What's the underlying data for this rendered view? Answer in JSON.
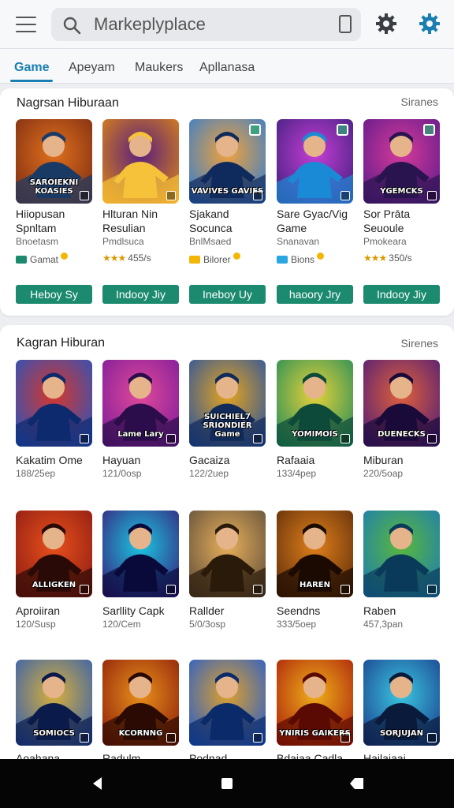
{
  "search": {
    "value": "Markeplyplace"
  },
  "tabs": [
    "Game",
    "Apeyam",
    "Maukers",
    "Apllanasa"
  ],
  "section1": {
    "title": "Nagrsan Hiburaan",
    "link": "Siranes",
    "apps": [
      {
        "tile_text": "SAROIEKNI KOASIES",
        "name": "Hiiopusan Spnltam",
        "sub": "Bnoetasm",
        "meta_icon": "green-tag-icon",
        "meta": "Gamat",
        "cta": "Heboy Sy"
      },
      {
        "tile_text": "",
        "name": "Hlturan Nin Resulian",
        "sub": "Pmdlsuca",
        "meta_icon": "stars",
        "stars": "★★★",
        "meta": "455/s",
        "cta": "Indooy Jiy"
      },
      {
        "tile_text": "VAVIVES GAVIES",
        "name": "Sjakand Socunca",
        "sub": "BnlMsaed",
        "meta_icon": "yellow-badge-icon",
        "meta": "Bilorer",
        "cta": "Ineboy Uy"
      },
      {
        "tile_text": "",
        "name": "Sare Gyac/Vig Game",
        "sub": "Snanavan",
        "meta_icon": "diamond-icon",
        "meta": "Bions",
        "cta": "haoory Jry"
      },
      {
        "tile_text": "YGEMCKS",
        "name": "Sor Prāta Seuoule",
        "sub": "Pmokeara",
        "meta_icon": "stars",
        "stars": "★★★",
        "meta": "350/s",
        "cta": "Indooy Jiy"
      }
    ]
  },
  "section2": {
    "title": "Kagran Hiburan",
    "link": "Sirenes",
    "row1": [
      {
        "tile_text": "",
        "name": "Kakatim Ome",
        "sub": "188/25ep"
      },
      {
        "tile_text": "Lame Lary",
        "name": "Hayuan",
        "sub": "121/0osp"
      },
      {
        "tile_text": "SUICHIEL7 SRIONDIER Game",
        "name": "Gacaiza",
        "sub": "122/2uep"
      },
      {
        "tile_text": "YOMIMOIS",
        "name": "Rafaaia",
        "sub": "133/4pep"
      },
      {
        "tile_text": "DUENECKS",
        "name": "Miburan",
        "sub": "220/5oap"
      }
    ],
    "row2": [
      {
        "tile_text": "ALLIGKEN",
        "name": "Aproiiran",
        "sub": "120/Susp"
      },
      {
        "tile_text": "",
        "name": "Sarllity Capk",
        "sub": "120/Cem"
      },
      {
        "tile_text": "",
        "name": "Rallder",
        "sub": "5/0/3osp"
      },
      {
        "tile_text": "HAREN",
        "name": "Seendns",
        "sub": "333/5oep"
      },
      {
        "tile_text": "",
        "name": "Raben",
        "sub": "457,3pan"
      }
    ],
    "row3": [
      {
        "tile_text": "SOMIOCS",
        "name": "Aoahana",
        "sub": ""
      },
      {
        "tile_text": "KCORNNG",
        "name": "Radulm",
        "sub": ""
      },
      {
        "tile_text": "",
        "name": "Podnad",
        "sub": ""
      },
      {
        "tile_text": "YNIRIS GAIKERS",
        "name": "Bdaiaa Cadla",
        "sub": ""
      },
      {
        "tile_text": "SORJUJAN",
        "name": "Hailaiaai",
        "sub": ""
      }
    ]
  },
  "colors": {
    "accent": "#1a7fb0",
    "cta": "#1b8a6f"
  },
  "icons": [
    "menu-icon",
    "search-icon",
    "phone-icon",
    "gear-icon",
    "settings-icon",
    "back-icon",
    "home-icon",
    "recents-icon"
  ]
}
